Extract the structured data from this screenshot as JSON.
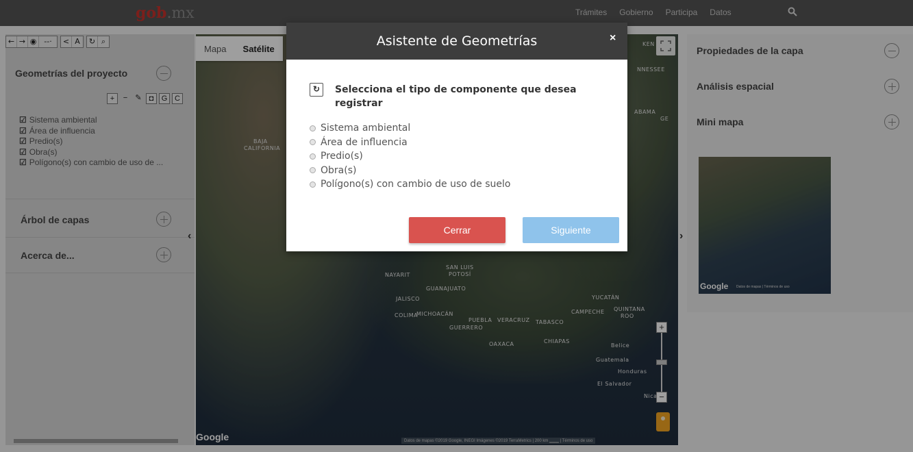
{
  "header": {
    "logo_main": "gob",
    "logo_suffix": ".mx",
    "nav": [
      "Trámites",
      "Gobierno",
      "Participa",
      "Datos"
    ]
  },
  "left_panel": {
    "toolbar_icons": [
      "arrow-left",
      "arrow-right",
      "pin",
      "measure",
      "share",
      "text",
      "refresh",
      "zoom"
    ],
    "geometrias_title": "Geometrías del proyecto",
    "geometrias_tools": [
      "+",
      "−",
      "✎"
    ],
    "geometrias_tools_box": [
      "◘",
      "G",
      "C"
    ],
    "geometrias_items": [
      "Sistema ambiental",
      "Área de influencia",
      "Predio(s)",
      "Obra(s)",
      "Polígono(s) con cambio de uso de ..."
    ],
    "arbol_title": "Árbol de capas",
    "acerca_title": "Acerca de..."
  },
  "map": {
    "tabs": [
      "Mapa",
      "Satélite"
    ],
    "labels": [
      {
        "text": "KEN"
      },
      {
        "text": "NNESSEE"
      },
      {
        "text": "ABAMA"
      },
      {
        "text": "GE"
      },
      {
        "text": "BAJA"
      },
      {
        "text": "CALIFORNIA"
      },
      {
        "text": "NAYARIT"
      },
      {
        "text": "SAN LUIS"
      },
      {
        "text": "POTOSÍ"
      },
      {
        "text": "GUANAJUATO"
      },
      {
        "text": "JALISCO"
      },
      {
        "text": "COLIMA"
      },
      {
        "text": "MICHOACÁN"
      },
      {
        "text": "PUEBLA"
      },
      {
        "text": "VERACRUZ"
      },
      {
        "text": "TABASCO"
      },
      {
        "text": "GUERRERO"
      },
      {
        "text": "OAXACA"
      },
      {
        "text": "CHIAPAS"
      },
      {
        "text": "YUCATÁN"
      },
      {
        "text": "CAMPECHE"
      },
      {
        "text": "QUINTANA"
      },
      {
        "text": "ROO"
      },
      {
        "text": "Belice"
      },
      {
        "text": "Guatemala"
      },
      {
        "text": "Honduras"
      },
      {
        "text": "El Salvador"
      },
      {
        "text": "Nica"
      }
    ],
    "google": "Google",
    "attribution": "Datos de mapas ©2019 Google, INEGI Imágenes ©2019 TerraMetrics | 200 km ▁▁▁ | Términos de uso"
  },
  "right_panel": {
    "sections": [
      {
        "title": "Propiedades de la capa",
        "state": "minus"
      },
      {
        "title": "Análisis espacial",
        "state": "plus"
      },
      {
        "title": "Mini mapa",
        "state": "plus"
      }
    ],
    "minimap_google": "Google",
    "minimap_attrib": "Datos de mapas | Términos de uso"
  },
  "modal": {
    "title": "Asistente de Geometrías",
    "close": "×",
    "question": "Selecciona el tipo de componente que desea registrar",
    "options": [
      "Sistema ambiental",
      "Área de influencia",
      "Predio(s)",
      "Obra(s)",
      "Polígono(s) con cambio de uso de suelo"
    ],
    "cerrar_label": "Cerrar",
    "siguiente_label": "Siguiente"
  },
  "colors": {
    "cerrar": "#d9534f",
    "siguiente": "#8fc3eb",
    "header": "#3d3d3d"
  }
}
